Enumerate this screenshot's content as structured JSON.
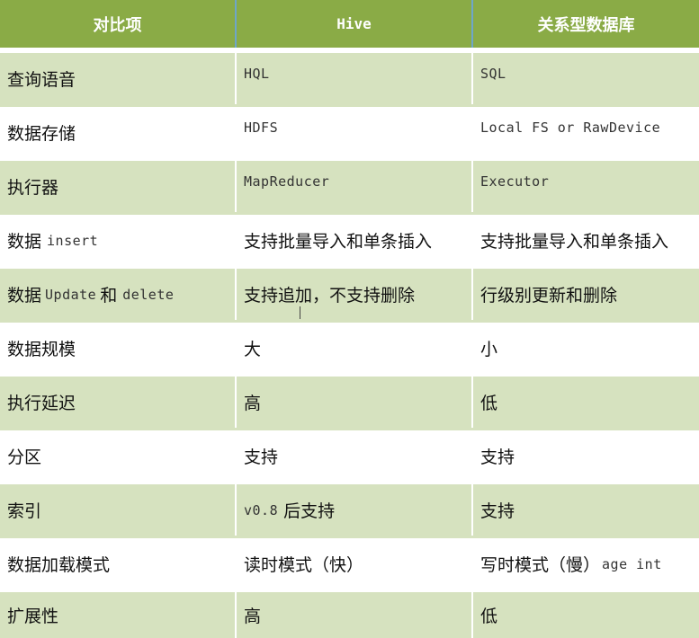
{
  "header": {
    "col1": "对比项",
    "col2": "Hive",
    "col3": "关系型数据库"
  },
  "rows": [
    {
      "item": "查询语音",
      "hive": "HQL",
      "rdbms": "SQL"
    },
    {
      "item": "数据存储",
      "hive": "HDFS",
      "rdbms": "Local FS or RawDevice"
    },
    {
      "item": "执行器",
      "hive": "MapReducer",
      "rdbms": "Executor"
    },
    {
      "item_prefix": "数据",
      "item_code": "insert",
      "hive": "支持批量导入和单条插入",
      "rdbms": "支持批量导入和单条插入"
    },
    {
      "item_prefix": "数据",
      "item_code": "Update",
      "item_mid": "和",
      "item_code2": "delete",
      "hive": "支持追加，不支持删除",
      "rdbms": "行级别更新和删除"
    },
    {
      "item": "数据规模",
      "hive": "大",
      "rdbms": "小"
    },
    {
      "item": "执行延迟",
      "hive": "高",
      "rdbms": "低"
    },
    {
      "item": "分区",
      "hive": "支持",
      "rdbms": "支持"
    },
    {
      "item": "索引",
      "hive_code": "v0.8",
      "hive_suffix": "后支持",
      "rdbms": "支持"
    },
    {
      "item": "数据加载模式",
      "hive": "读时模式（快）",
      "rdbms_prefix": "写时模式（慢）",
      "rdbms_code": "age int"
    },
    {
      "item": "扩展性",
      "hive": "高",
      "rdbms": "低"
    }
  ]
}
